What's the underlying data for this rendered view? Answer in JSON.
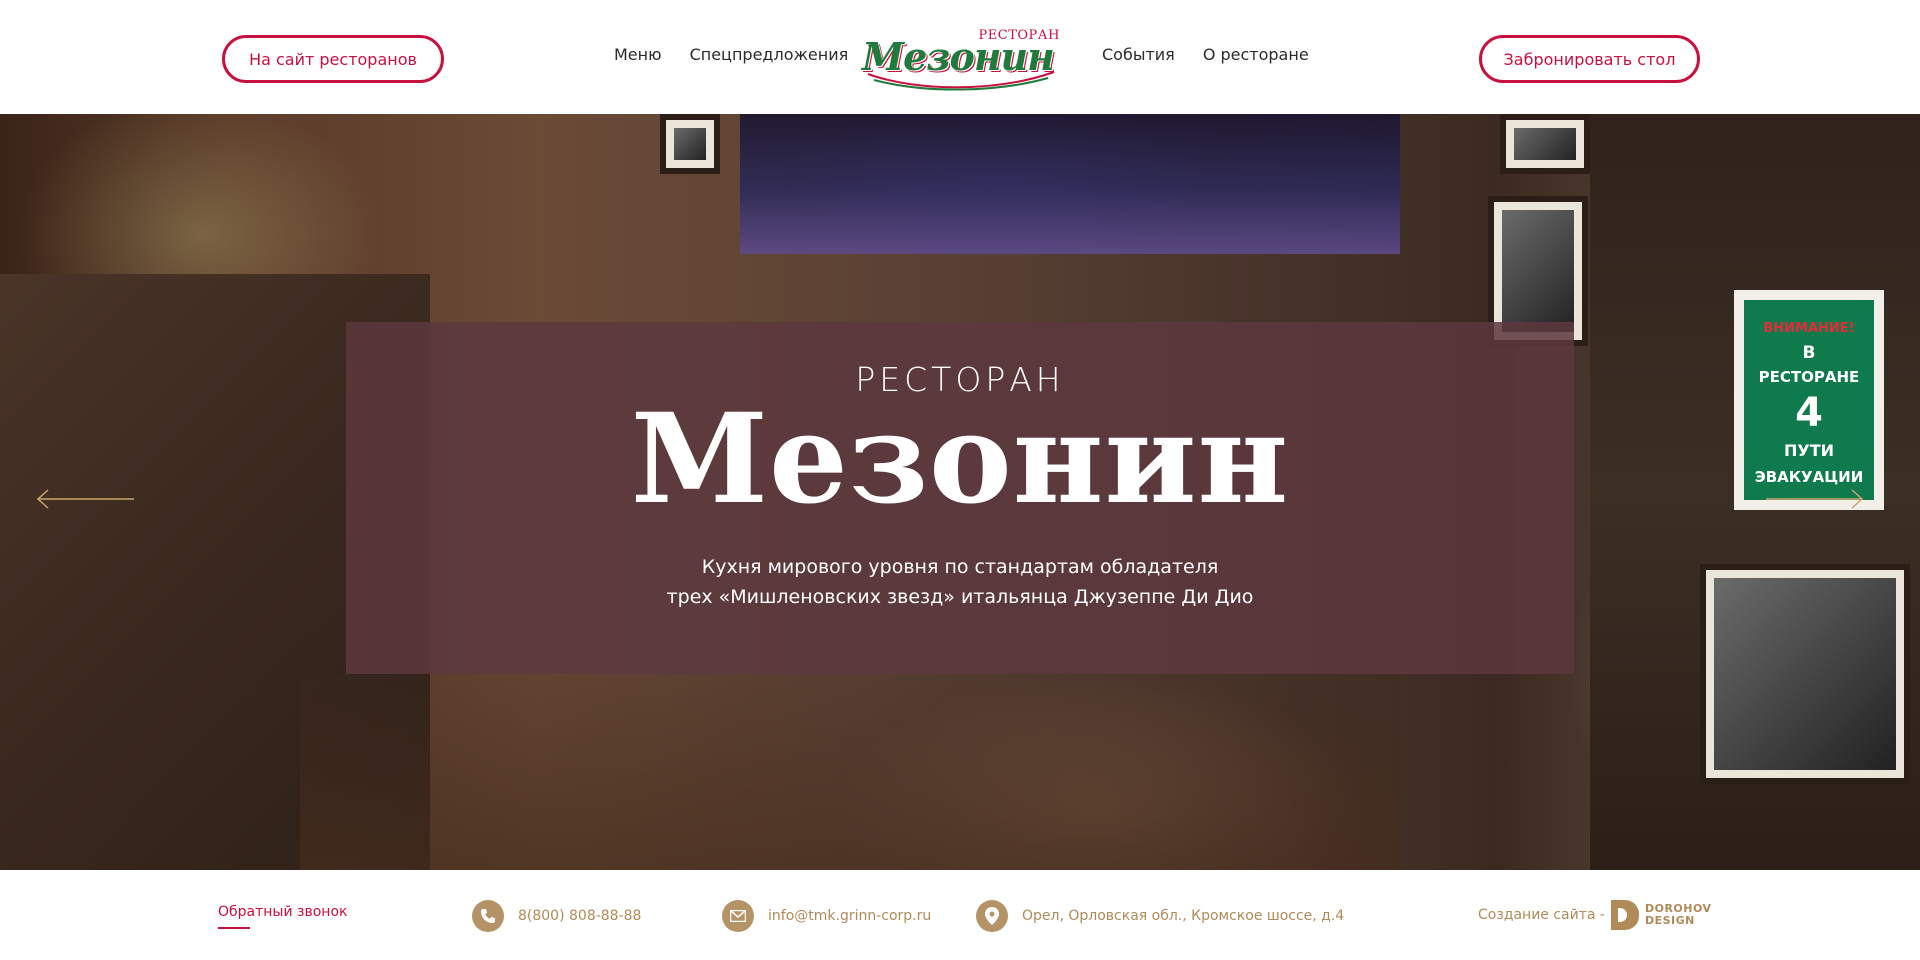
{
  "header": {
    "sites_button": "На сайт ресторанов",
    "book_button": "Забронировать стол",
    "nav_left": [
      "Меню",
      "Спецпредложения"
    ],
    "nav_right": [
      "События",
      "О ресторане"
    ],
    "logo": {
      "small_text": "РЕСТОРАН",
      "script_text": "Мезонин"
    }
  },
  "hero": {
    "kicker": "РЕСТОРАН",
    "title": "Мезонин",
    "subtitle_line1": "Кухня мирового уровня по стандартам обладателя",
    "subtitle_line2": "трех «Мишленовских звезд» итальянца Джузеппе Ди Дио",
    "sign_lines": [
      "ВНИМАНИЕ!",
      "В",
      "РЕСТОРАНЕ",
      "4",
      "ПУТИ",
      "ЭВАКУАЦИИ"
    ]
  },
  "footer": {
    "callback": "Обратный звонок",
    "phone": "8(800) 808-88-88",
    "email": "info@tmk.grinn-corp.ru",
    "address": "Орел, Орловская обл., Кромское шоссе, д.4",
    "creator_label": "Создание сайта -",
    "creator_brand_line1": "DOROHOV",
    "creator_brand_line2": "DESIGN"
  },
  "colors": {
    "accent": "#c8103e",
    "gold": "#b08a57",
    "logo_green": "#1f7a3c",
    "overlay": "#5c383e"
  },
  "icons": {
    "phone": "phone-icon",
    "mail": "mail-icon",
    "location": "location-pin-icon",
    "prev": "arrow-left-icon",
    "next": "arrow-right-icon"
  }
}
